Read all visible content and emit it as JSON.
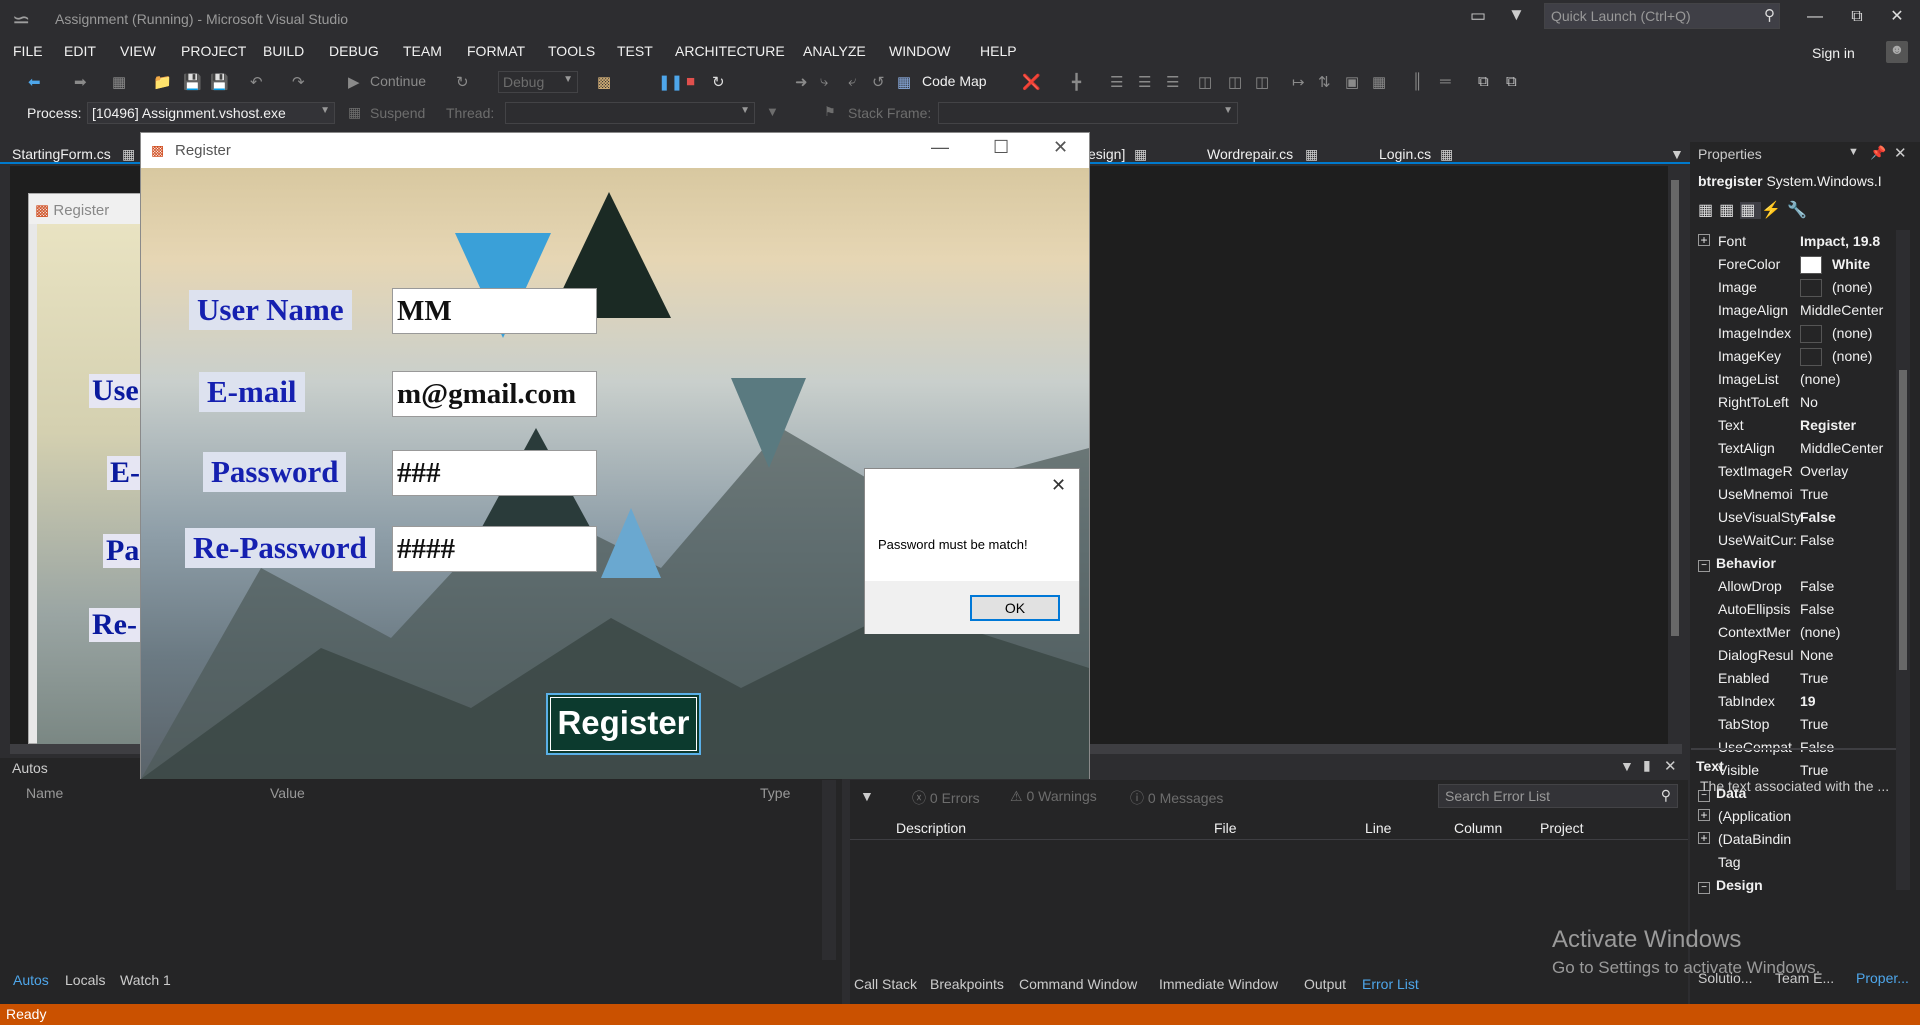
{
  "window": {
    "title": "Assignment (Running) - Microsoft Visual Studio",
    "quick_launch_placeholder": "Quick Launch (Ctrl+Q)",
    "sign_in": "Sign in"
  },
  "menu": [
    "FILE",
    "EDIT",
    "VIEW",
    "PROJECT",
    "BUILD",
    "DEBUG",
    "TEAM",
    "FORMAT",
    "TOOLS",
    "TEST",
    "ARCHITECTURE",
    "ANALYZE",
    "WINDOW",
    "HELP"
  ],
  "toolbar": {
    "continue_label": "Continue",
    "config": "Debug",
    "code_map": "Code Map",
    "process_label": "Process:",
    "process_value": "[10496] Assignment.vshost.exe",
    "suspend_label": "Suspend",
    "thread_label": "Thread:",
    "stack_frame_label": "Stack Frame:"
  },
  "doc_tabs": [
    "StartingForm.cs",
    "esign]",
    "Wordrepair.cs",
    "Login.cs"
  ],
  "bg_form": {
    "title": "Register",
    "labels": [
      "Use",
      "E-",
      "Pa",
      "Re-"
    ]
  },
  "register_window": {
    "title": "Register",
    "fields": [
      {
        "label": "User Name",
        "value": "MM"
      },
      {
        "label": "E-mail",
        "value": "m@gmail.com"
      },
      {
        "label": "Password",
        "value": "###"
      },
      {
        "label": "Re-Password",
        "value": "####"
      }
    ],
    "button": "Register"
  },
  "message_box": {
    "text": "Password must be match!",
    "ok": "OK"
  },
  "properties": {
    "header": "Properties",
    "object_name": "btregister",
    "object_type": "System.Windows.I",
    "rows": [
      {
        "name": "Font",
        "value": "Impact, 19.8",
        "bold": true,
        "expand": true
      },
      {
        "name": "ForeColor",
        "value": "White",
        "bold": true,
        "swatch": "#ffffff"
      },
      {
        "name": "Image",
        "value": "(none)",
        "swatch": "#252526"
      },
      {
        "name": "ImageAlign",
        "value": "MiddleCenter"
      },
      {
        "name": "ImageIndex",
        "value": "(none)",
        "swatch": "#252526"
      },
      {
        "name": "ImageKey",
        "value": "(none)",
        "swatch": "#252526"
      },
      {
        "name": "ImageList",
        "value": "(none)"
      },
      {
        "name": "RightToLeft",
        "value": "No"
      },
      {
        "name": "Text",
        "value": "Register",
        "bold": true
      },
      {
        "name": "TextAlign",
        "value": "MiddleCenter"
      },
      {
        "name": "TextImageR",
        "value": "Overlay"
      },
      {
        "name": "UseMnemoi",
        "value": "True"
      },
      {
        "name": "UseVisualSty",
        "value": "False",
        "bold": true
      },
      {
        "name": "UseWaitCur:",
        "value": "False"
      },
      {
        "category": "Behavior"
      },
      {
        "name": "AllowDrop",
        "value": "False"
      },
      {
        "name": "AutoEllipsis",
        "value": "False"
      },
      {
        "name": "ContextMer",
        "value": "(none)"
      },
      {
        "name": "DialogResul",
        "value": "None"
      },
      {
        "name": "Enabled",
        "value": "True"
      },
      {
        "name": "TabIndex",
        "value": "19",
        "bold": true
      },
      {
        "name": "TabStop",
        "value": "True"
      },
      {
        "name": "UseCompat",
        "value": "False"
      },
      {
        "name": "Visible",
        "value": "True"
      },
      {
        "category": "Data"
      },
      {
        "name": "(Application",
        "value": "",
        "expand": true
      },
      {
        "name": "(DataBindin",
        "value": "",
        "expand": true
      },
      {
        "name": "Tag",
        "value": ""
      },
      {
        "category": "Design"
      }
    ],
    "desc_title": "Text",
    "desc_text": "The text associated with the ..."
  },
  "autos": {
    "title": "Autos",
    "columns": [
      "Name",
      "Value",
      "Type"
    ],
    "tabs": [
      "Autos",
      "Locals",
      "Watch 1"
    ]
  },
  "error_list": {
    "errors": "0 Errors",
    "warnings": "0 Warnings",
    "messages": "0 Messages",
    "search_placeholder": "Search Error List",
    "columns": [
      "Description",
      "File",
      "Line",
      "Column",
      "Project"
    ],
    "tabs": [
      "Call Stack",
      "Breakpoints",
      "Command Window",
      "Immediate Window",
      "Output",
      "Error List"
    ]
  },
  "right_bottom_tabs": [
    "Solutio...",
    "Team E...",
    "Proper..."
  ],
  "watermark": {
    "line1": "Activate Windows",
    "line2": "Go to Settings to activate Windows."
  },
  "status": "Ready",
  "colors": {
    "accent": "#007acc",
    "status_bar": "#ca5100",
    "label_blue": "#1520b0"
  }
}
